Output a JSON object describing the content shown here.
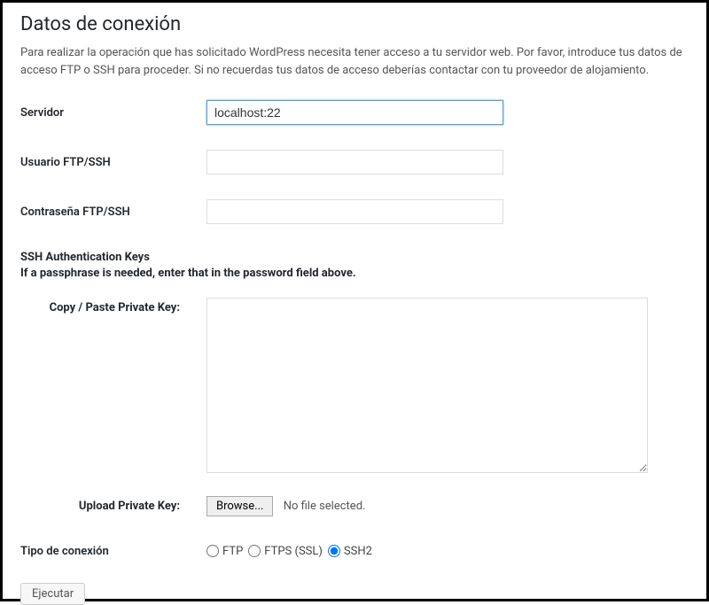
{
  "title": "Datos de conexión",
  "intro": "Para realizar la operación que has solicitado WordPress necesita tener acceso a tu servidor web. Por favor, introduce tus datos de acceso FTP o SSH para proceder. Si no recuerdas tus datos de acceso deberías contactar con tu proveedor de alojamiento.",
  "fields": {
    "hostname_label": "Servidor",
    "hostname_value": "localhost:22",
    "username_label": "Usuario FTP/SSH",
    "username_value": "",
    "password_label": "Contraseña FTP/SSH",
    "password_value": ""
  },
  "ssh_keys": {
    "heading": "SSH Authentication Keys",
    "sub": "If a passphrase is needed, enter that in the password field above.",
    "private_key_label": "Copy / Paste Private Key:",
    "private_key_value": "",
    "upload_label": "Upload Private Key:",
    "browse_label": "Browse...",
    "no_file": "No file selected."
  },
  "connection_type": {
    "label": "Tipo de conexión",
    "options": {
      "ftp": "FTP",
      "ftps": "FTPS (SSL)",
      "ssh2": "SSH2"
    },
    "selected": "ssh2"
  },
  "submit_label": "Ejecutar"
}
